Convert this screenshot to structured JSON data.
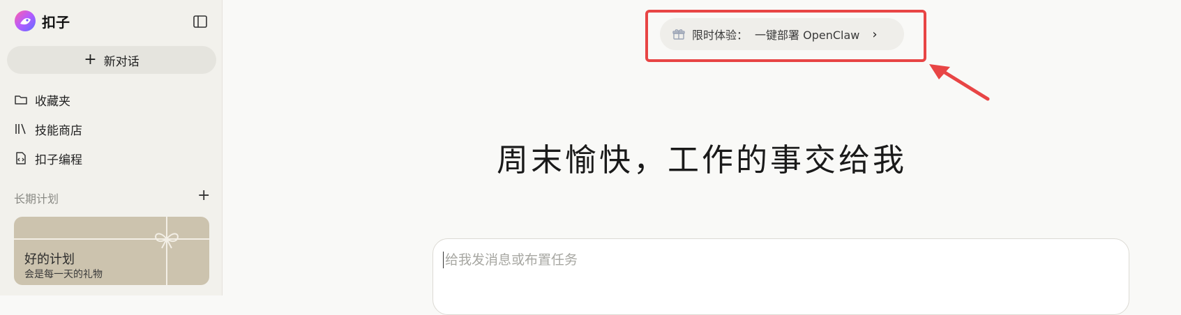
{
  "brand": {
    "name": "扣子"
  },
  "sidebar": {
    "new_chat_label": "新对话",
    "items": [
      {
        "label": "收藏夹",
        "icon": "folder-icon"
      },
      {
        "label": "技能商店",
        "icon": "library-icon"
      },
      {
        "label": "扣子编程",
        "icon": "code-file-icon"
      }
    ],
    "section_title": "长期计划",
    "section_add": "+",
    "plan_card": {
      "title": "好的计划",
      "subtitle": "会是每一天的礼物"
    }
  },
  "promo": {
    "label": "限时体验：",
    "text": "一键部署 OpenClaw",
    "chevron": "›"
  },
  "hero": {
    "title": "周末愉快，工作的事交给我"
  },
  "composer": {
    "placeholder": "给我发消息或布置任务"
  },
  "colors": {
    "highlight": "#e84545",
    "sidebar_bg": "#f2f1ec",
    "card_bg": "#ccc3ae"
  }
}
